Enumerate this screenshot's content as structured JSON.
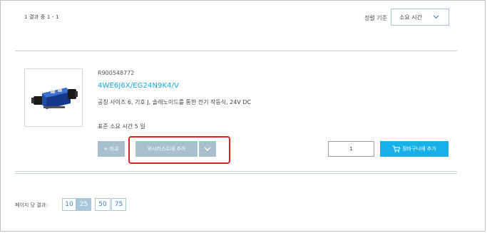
{
  "results": {
    "count_text": "1 결과 중 1 - 1"
  },
  "sort": {
    "label": "정렬 기준",
    "selected": "소요 시간"
  },
  "product": {
    "sku": "R900548772",
    "name": "4WE6J6X/EG24N9K4/V",
    "description": "공칭 사이즈 6, 기호 J, 솔레노이드를 통한 전기 작동식, 24V DC",
    "lead_time": "표준 소요 시간 5 일",
    "image_icon": "hydraulic-valve-image"
  },
  "actions": {
    "compare_label": "+ 비교",
    "wishlist_label": "위시리스트에 추가",
    "quantity": "1",
    "cart_label": "장바구니에 추가"
  },
  "pagination": {
    "label": "페이지 당 결과:",
    "options": [
      "10",
      "25",
      "50",
      "75"
    ],
    "selected": "25"
  },
  "colors": {
    "accent": "#18b0ea",
    "link": "#1aa7e0",
    "button_gray": "#a8bfcc",
    "highlight": "#e02020"
  }
}
